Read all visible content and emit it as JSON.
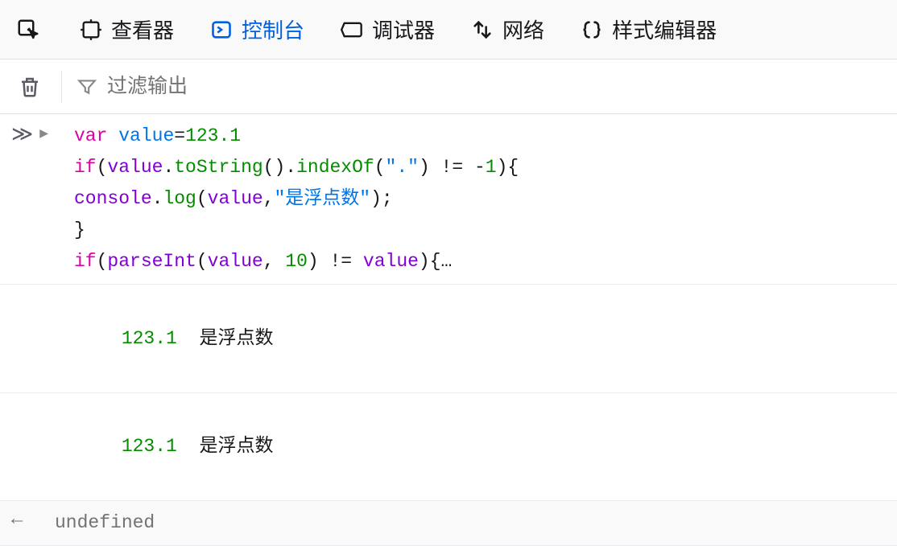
{
  "toolbar": {
    "tabs": [
      {
        "label": "查看器"
      },
      {
        "label": "控制台"
      },
      {
        "label": "调试器"
      },
      {
        "label": "网络"
      },
      {
        "label": "样式编辑器"
      }
    ]
  },
  "filter": {
    "placeholder": "过滤输出"
  },
  "input": {
    "prompt": "≫",
    "code_text": "var value=123.1\nif(value.toString().indexOf(\".\") != -1){\nconsole.log(value,\"是浮点数\");\n}\nif(parseInt(value, 10) != value){…",
    "tokens": [
      [
        {
          "t": "var",
          "c": "kw"
        },
        {
          "t": " ",
          "c": "pun"
        },
        {
          "t": "value",
          "c": "def"
        },
        {
          "t": "=",
          "c": "pun"
        },
        {
          "t": "123.1",
          "c": "num"
        }
      ],
      [
        {
          "t": "if",
          "c": "kw"
        },
        {
          "t": "(",
          "c": "pun"
        },
        {
          "t": "value",
          "c": "var"
        },
        {
          "t": ".",
          "c": "pun"
        },
        {
          "t": "toString",
          "c": "prop"
        },
        {
          "t": "().",
          "c": "pun"
        },
        {
          "t": "indexOf",
          "c": "prop"
        },
        {
          "t": "(",
          "c": "pun"
        },
        {
          "t": "\".\"",
          "c": "str"
        },
        {
          "t": ") != -",
          "c": "pun"
        },
        {
          "t": "1",
          "c": "num"
        },
        {
          "t": "){",
          "c": "pun"
        }
      ],
      [
        {
          "t": "console",
          "c": "var"
        },
        {
          "t": ".",
          "c": "pun"
        },
        {
          "t": "log",
          "c": "prop"
        },
        {
          "t": "(",
          "c": "pun"
        },
        {
          "t": "value",
          "c": "var"
        },
        {
          "t": ",",
          "c": "pun"
        },
        {
          "t": "\"是浮点数\"",
          "c": "str"
        },
        {
          "t": ");",
          "c": "pun"
        }
      ],
      [
        {
          "t": "}",
          "c": "pun"
        }
      ],
      [
        {
          "t": "if",
          "c": "kw"
        },
        {
          "t": "(",
          "c": "pun"
        },
        {
          "t": "parseInt",
          "c": "var"
        },
        {
          "t": "(",
          "c": "pun"
        },
        {
          "t": "value",
          "c": "var"
        },
        {
          "t": ", ",
          "c": "pun"
        },
        {
          "t": "10",
          "c": "num"
        },
        {
          "t": ") != ",
          "c": "pun"
        },
        {
          "t": "value",
          "c": "var"
        },
        {
          "t": "){…",
          "c": "pun"
        }
      ]
    ]
  },
  "output": [
    {
      "index": "123.1",
      "text": "是浮点数"
    },
    {
      "index": "123.1",
      "text": "是浮点数"
    }
  ],
  "return_value": "undefined"
}
